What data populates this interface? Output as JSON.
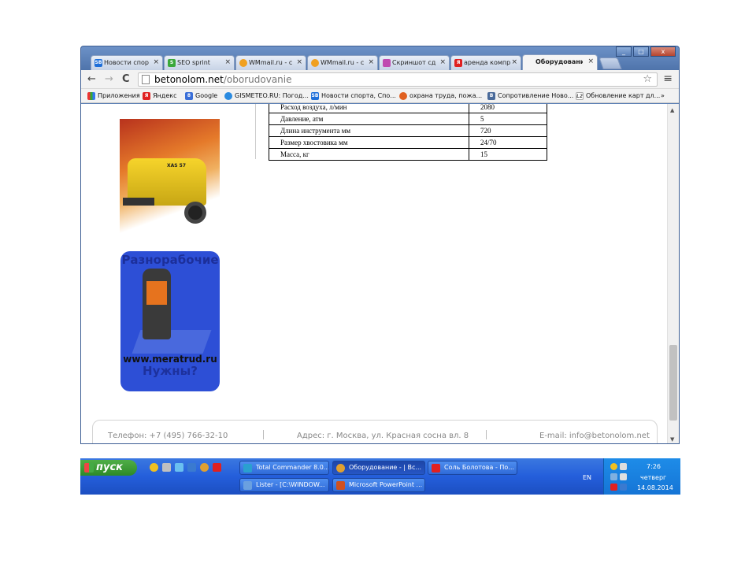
{
  "browser": {
    "tabs": [
      {
        "label": "Новости спор",
        "fav": "SB",
        "fav_color": "#1e6fd9"
      },
      {
        "label": "SEO sprint",
        "fav": "S",
        "fav_color": "#3aa83a"
      },
      {
        "label": "WMmail.ru - с",
        "fav": "",
        "fav_color": "#f0a020"
      },
      {
        "label": "WMmail.ru - с",
        "fav": "",
        "fav_color": "#f0a020"
      },
      {
        "label": "Скриншот сд",
        "fav": "",
        "fav_color": "#c04ab0"
      },
      {
        "label": "аренда компр",
        "fav": "Я",
        "fav_color": "#e02020"
      },
      {
        "label": "Оборудовани",
        "fav": "",
        "fav_color": "#f5f5f5"
      }
    ],
    "close_glyph": "×",
    "window_controls": {
      "minimize": "_",
      "maximize": "□",
      "close": "x"
    },
    "nav": {
      "back": "←",
      "forward": "→",
      "reload": "C"
    },
    "url": {
      "host": "betonolom.net",
      "path": "/oborudovanie"
    },
    "star": "☆",
    "menu": "≡",
    "bookmarks": [
      {
        "label": "Приложения",
        "icon": "apps-icon",
        "color": "#d04040"
      },
      {
        "label": "Яндекс",
        "icon": "yandex-icon",
        "color": "#e02020",
        "badge": "Я"
      },
      {
        "label": "Google",
        "icon": "google-icon",
        "color": "#3a6fd8",
        "badge": "8"
      },
      {
        "label": "GISMETEO.RU: Погод...",
        "icon": "gismeteo-icon",
        "color": "#2a8ae0",
        "badge": ""
      },
      {
        "label": "Новости спорта, Спо...",
        "icon": "sb-icon",
        "color": "#1e6fd9",
        "badge": "SB"
      },
      {
        "label": "охрана труда, пожа...",
        "icon": "ohrana-icon",
        "color": "#e06020",
        "badge": ""
      },
      {
        "label": "Сопротивление Ново...",
        "icon": "vk-icon",
        "color": "#4a6a9a",
        "badge": "B"
      },
      {
        "label": "Обновление карт дл...",
        "icon": "l2-icon",
        "color": "#ffffff",
        "badge": "L2"
      }
    ],
    "bookmarks_more": "»"
  },
  "page": {
    "spec_rows": [
      {
        "name": "Расход воздуха, л/мин",
        "value": "2080"
      },
      {
        "name": "Давление, атм",
        "value": "5"
      },
      {
        "name": "Длина инструмента мм",
        "value": "720"
      },
      {
        "name": "Размер хвостовика мм",
        "value": "24/70"
      },
      {
        "name": "Масса, кг",
        "value": "15"
      }
    ],
    "compressor_brand": "XAS 57",
    "banner": {
      "headline": "Разнорабочие",
      "site": "www.meratrud.ru",
      "tagline": "Нужны?"
    },
    "footer": {
      "phone": "Телефон:  +7 (495) 766-32-10",
      "address": "Адрес: г. Москва, ул. Красная сосна вл. 8",
      "email": "E-mail: info@betonolom.net"
    }
  },
  "taskbar": {
    "start": "пуск",
    "windows": [
      {
        "label": "Total Commander 8.0...",
        "color": "#2aa0d0"
      },
      {
        "label": "Оборудование - | Вс...",
        "color": "#e0a030",
        "active": true
      },
      {
        "label": "Соль Болотова - По...",
        "color": "#e02020"
      },
      {
        "label": "Lister - [C:\\WINDOW...",
        "color": "#6aa0e0"
      },
      {
        "label": "Microsoft PowerPoint ...",
        "color": "#d05020"
      }
    ],
    "lang": "EN",
    "clock": {
      "time": "7:26",
      "day": "четверг",
      "date": "14.08.2014"
    }
  }
}
